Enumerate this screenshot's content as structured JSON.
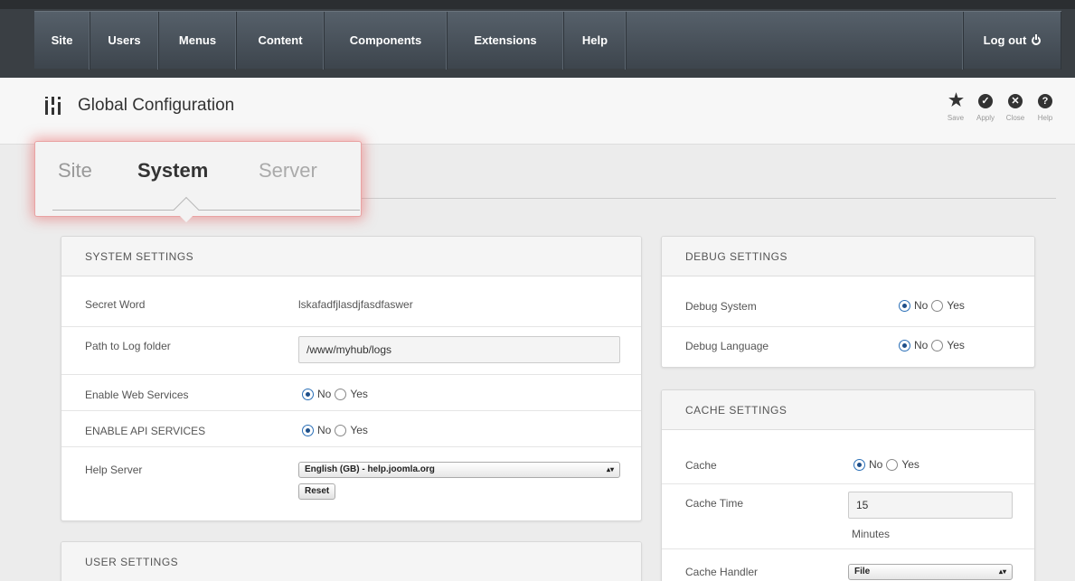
{
  "nav": {
    "items": [
      "Site",
      "Users",
      "Menus",
      "Content",
      "Components",
      "Extensions",
      "Help"
    ],
    "logout": "Log out"
  },
  "header": {
    "title": "Global Configuration",
    "toolbar": [
      "Save",
      "Apply",
      "Close",
      "Help"
    ]
  },
  "tabs": [
    "Site",
    "System",
    "Server"
  ],
  "active_tab": "System",
  "system": {
    "heading": "SYSTEM SETTINGS",
    "secret_label": "Secret Word",
    "secret_value": "lskafadfjlasdjfasdfaswer",
    "log_label": "Path to Log folder",
    "log_value": "/www/myhub/logs",
    "ws_label": "Enable Web Services",
    "api_label": "ENABLE API SERVICES",
    "help_label": "Help Server",
    "help_value": "English (GB) - help.joomla.org",
    "reset": "Reset",
    "no": "No",
    "yes": "Yes"
  },
  "user": {
    "heading": "USER SETTINGS"
  },
  "debug": {
    "heading": "DEBUG SETTINGS",
    "system_label": "Debug System",
    "language_label": "Debug Language"
  },
  "cache": {
    "heading": "CACHE SETTINGS",
    "cache_label": "Cache",
    "time_label": "Cache Time",
    "time_value": "15",
    "time_unit": "Minutes",
    "handler_label": "Cache Handler",
    "handler_value": "File"
  },
  "colors": {
    "nav_bg": "#4a535c",
    "accent": "#1e4f8a",
    "highlight": "#e85a5a"
  }
}
